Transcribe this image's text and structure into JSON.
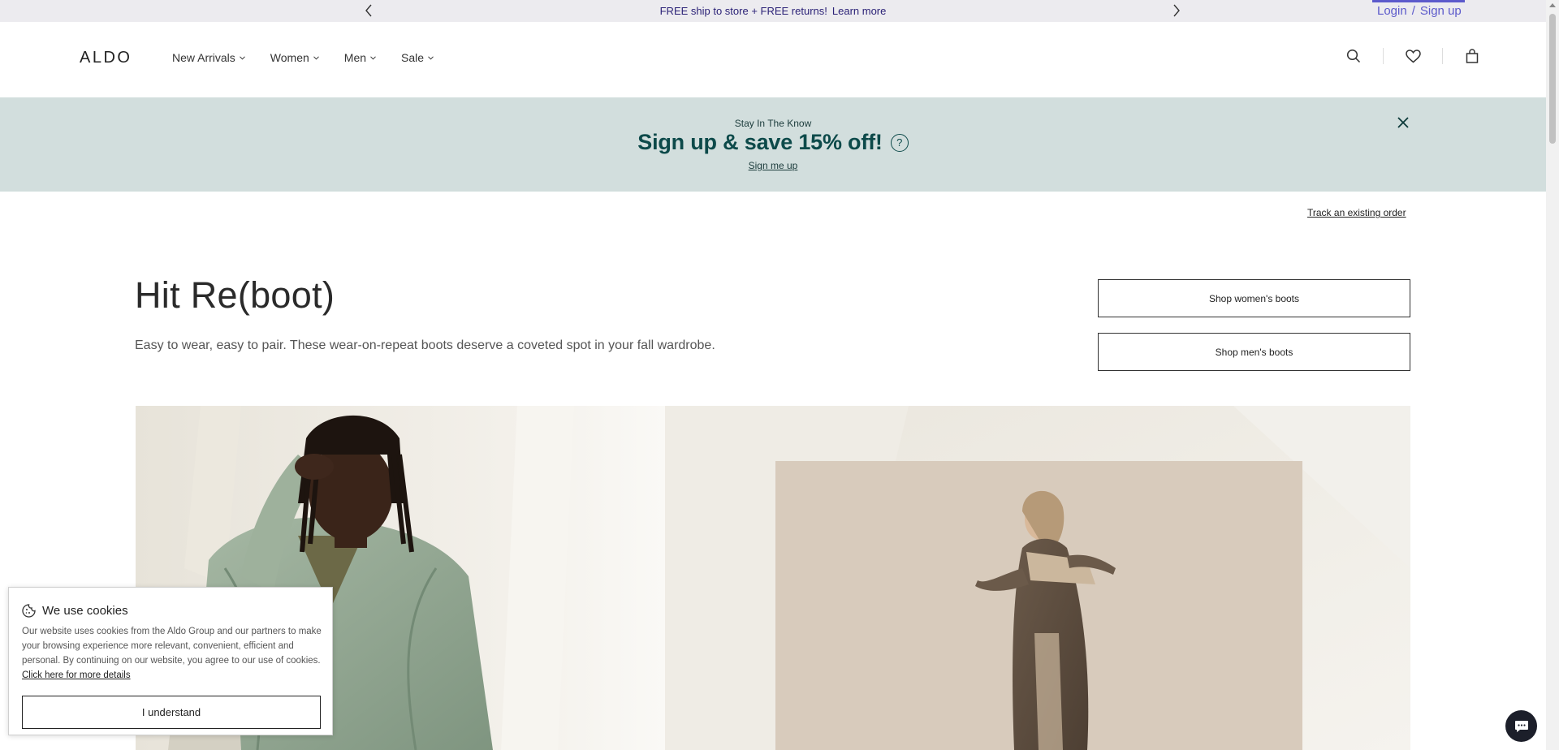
{
  "promo": {
    "message": "FREE ship to store + FREE returns!",
    "link": "Learn more"
  },
  "account": {
    "login": "Login",
    "separator": "/",
    "signup": "Sign up"
  },
  "brand": {
    "logo_text": "ALDO"
  },
  "nav": {
    "items": [
      {
        "label": "New Arrivals"
      },
      {
        "label": "Women"
      },
      {
        "label": "Men"
      },
      {
        "label": "Sale"
      }
    ]
  },
  "header_icons": [
    "search-icon",
    "heart-icon",
    "bag-icon"
  ],
  "signup_banner": {
    "kicker": "Stay In The Know",
    "title": "Sign up & save 15% off!",
    "help_glyph": "?",
    "link": "Sign me up"
  },
  "track_order": "Track an existing order",
  "hero": {
    "title": "Hit Re(boot)",
    "subtitle": "Easy to wear, easy to pair. These wear-on-repeat boots deserve a coveted spot in your fall wardrobe.",
    "cta_women": "Shop women's boots",
    "cta_men": "Shop men's boots"
  },
  "cookie": {
    "title": "We use cookies",
    "body": "Our website uses cookies from the Aldo Group and our partners to make your browsing experience more relevant, convenient, efficient and personal. By continuing on our website, you agree to our use of cookies.",
    "link": "Click here for more details",
    "button": "I understand"
  },
  "colors": {
    "promo_bg": "#ecebef",
    "promo_text": "#2b2277",
    "login_accent": "#5c5acb",
    "banner_bg": "#d2dedd",
    "banner_title": "#0d4a4a",
    "chat_bg": "#1c1f2a"
  }
}
